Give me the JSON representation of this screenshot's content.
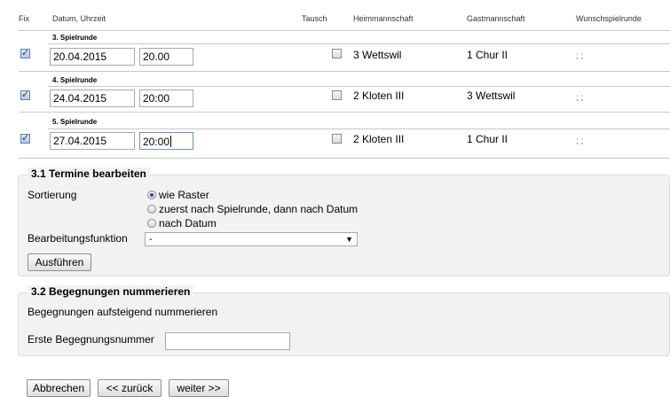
{
  "headers": {
    "fix": "Fix",
    "datum": "Datum, Uhrzeit",
    "tausch": "Tausch",
    "heim": "Heimmannschaft",
    "gast": "Gastmannschaft",
    "wunsch": "Wunschspielrunde"
  },
  "rows": [
    {
      "round": "3. Spielrunde",
      "fix": true,
      "date": "20.04.2015",
      "time": "20.00",
      "tausch": false,
      "home": "3 Wettswil",
      "away": "1 Chur II",
      "wish": "; ;"
    },
    {
      "round": "4. Spielrunde",
      "fix": true,
      "date": "24.04.2015",
      "time": "20:00",
      "tausch": false,
      "home": "2 Kloten III",
      "away": "3 Wettswil",
      "wish": "; ;"
    },
    {
      "round": "5. Spielrunde",
      "fix": true,
      "date": "27.04.2015",
      "time": "20:00",
      "tausch": false,
      "home": "2 Kloten III",
      "away": "1 Chur II",
      "wish": "; ;"
    }
  ],
  "section31": {
    "legend": "3.1 Termine bearbeiten",
    "sort_label": "Sortierung",
    "sort_options": [
      "wie Raster",
      "zuerst nach Spielrunde, dann nach Datum",
      "nach Datum"
    ],
    "sort_selected": 0,
    "func_label": "Bearbeitungsfunktion",
    "func_value": "-",
    "run_button": "Ausführen"
  },
  "section32": {
    "legend": "3.2 Begegnungen nummerieren",
    "desc": "Begegnungen aufsteigend nummerieren",
    "first_label": "Erste Begegnungsnummer",
    "first_value": ""
  },
  "footer": {
    "cancel": "Abbrechen",
    "back": "<< zurück",
    "next": "weiter >>"
  }
}
